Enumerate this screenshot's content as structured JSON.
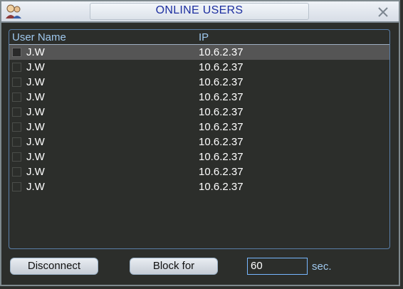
{
  "window": {
    "title": "ONLINE USERS"
  },
  "icons": {
    "title": "users-icon",
    "close": "close-icon"
  },
  "table": {
    "columns": [
      "User Name",
      "IP"
    ],
    "rows": [
      {
        "name": "J.W",
        "ip": "10.6.2.37",
        "selected": true
      },
      {
        "name": "J.W",
        "ip": "10.6.2.37"
      },
      {
        "name": "J.W",
        "ip": "10.6.2.37"
      },
      {
        "name": "J.W",
        "ip": "10.6.2.37"
      },
      {
        "name": "J.W",
        "ip": "10.6.2.37"
      },
      {
        "name": "J.W",
        "ip": "10.6.2.37"
      },
      {
        "name": "J.W",
        "ip": "10.6.2.37"
      },
      {
        "name": "J.W",
        "ip": "10.6.2.37"
      },
      {
        "name": "J.W",
        "ip": "10.6.2.37"
      },
      {
        "name": "J.W",
        "ip": "10.6.2.37"
      }
    ]
  },
  "footer": {
    "disconnect_label": "Disconnect",
    "block_label": "Block for",
    "block_value": "60",
    "unit": "sec."
  },
  "colors": {
    "title_text": "#1d2fa0",
    "header_text": "#9fc8ee",
    "background": "#2c2e2b",
    "selected_row": "#555555"
  }
}
